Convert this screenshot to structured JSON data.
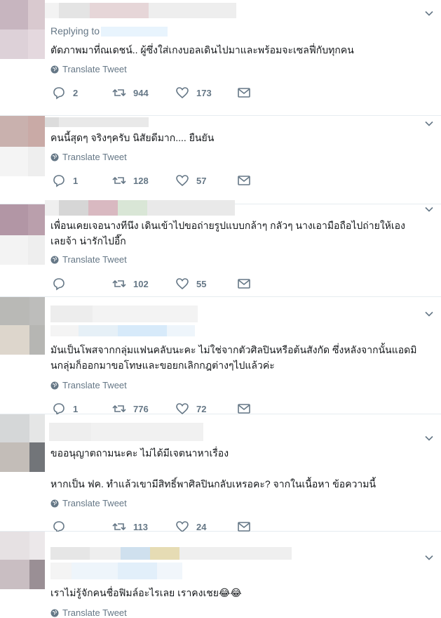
{
  "colors": {
    "accent": "#1da1f2",
    "secondary_text": "#657786",
    "border": "#e6ecf0"
  },
  "icons": {
    "reply": "reply-icon",
    "retweet": "retweet-icon",
    "like": "heart-icon",
    "dm": "mail-icon",
    "translate": "globe-icon",
    "menu": "chevron-down-icon"
  },
  "replies": [
    {
      "replying_to_label": "Replying to",
      "text": [
        "ตัดภาพมาที่ณเดชน์.. ผู้ซึ่งใส่เกงบอลเดินไปมาและพร้อมจะเซลฟี่กับทุกคน"
      ],
      "translate": "Translate Tweet",
      "reply_count": "2",
      "retweet_count": "944",
      "like_count": "173"
    },
    {
      "text": [
        "คนนี้สุดๆ จริงๆครับ นิสัยดีมาก.... ยืนยัน"
      ],
      "translate": "Translate Tweet",
      "reply_count": "1",
      "retweet_count": "128",
      "like_count": "57"
    },
    {
      "text": [
        "เพื่อนเคยเจอนางทีนึง เดินเข้าไปขอถ่ายรูปแบบกล้าๆ กลัวๆ นางเอามือถือไปถ่ายให้เอง",
        "เลยจ้า น่ารักไปอี๊ก"
      ],
      "translate": "Translate Tweet",
      "reply_count": "",
      "retweet_count": "102",
      "like_count": "55"
    },
    {
      "text": [
        "มันเป็นโพสจากกลุ่มแฟนคลับนะคะ ไม่ใช่จากตัวศิลปินหรือต้นสังกัด ซึ่งหลังจากนั้นแอดมิ",
        "นกลุ่มก็ออกมาขอโทษและขอยกเลิกกฎต่างๆไปแล้วค่ะ"
      ],
      "translate": "Translate Tweet",
      "reply_count": "1",
      "retweet_count": "776",
      "like_count": "72"
    },
    {
      "text": [
        "ขออนุญาตถามนะคะ ไม่ได้มีเจตนาหาเรื่อง",
        "",
        "หากเป็น ฟค. ทำแล้วเขามีสิทธิ์พาศิลปินกลับเหรอคะ? จากในเนื้อหา ข้อความนี้"
      ],
      "translate": "Translate Tweet",
      "reply_count": "",
      "retweet_count": "113",
      "like_count": "24"
    },
    {
      "text": [
        "เราไม่รู้จักคนชื่อฟิมล์อะไรเลย เราคงเชย😂😂"
      ],
      "translate": "Translate Tweet"
    }
  ]
}
